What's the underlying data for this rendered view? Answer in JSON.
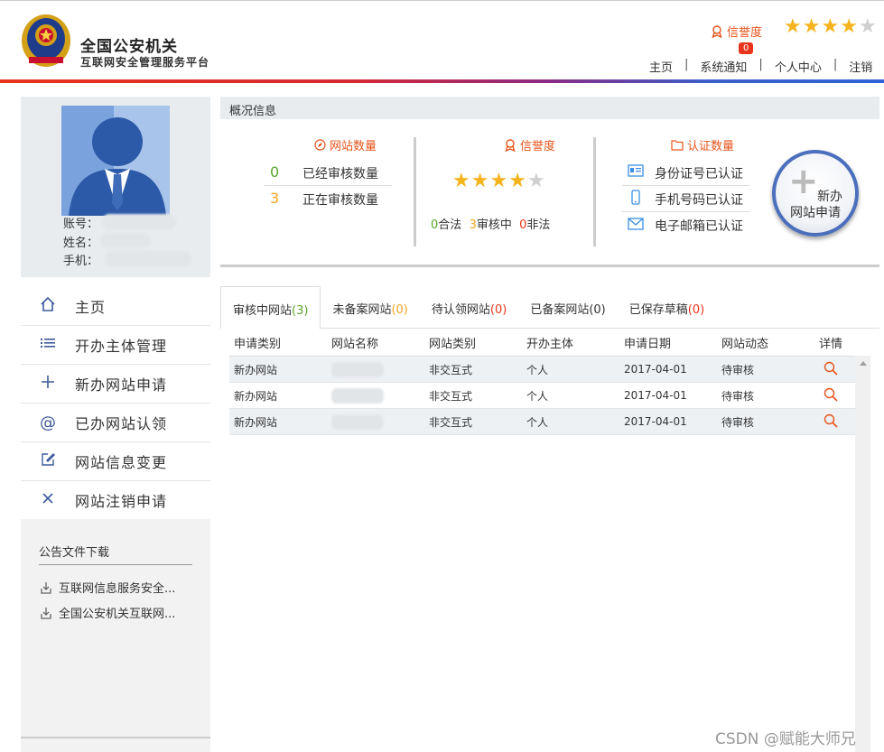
{
  "header": {
    "title": "全国公安机关",
    "subtitle": "互联网安全管理服务平台",
    "credit_label": "信誉度",
    "credit_stars": 4,
    "credit_stars_max": 5,
    "notice_count": "0",
    "nav": [
      "主页",
      "系统通知",
      "个人中心",
      "注销"
    ],
    "nav_sep": "|"
  },
  "profile": {
    "account_label": "账号：",
    "name_label": "姓名：",
    "phone_label": "手机："
  },
  "sidebar": {
    "items": [
      {
        "icon": "home-icon",
        "label": "主页"
      },
      {
        "icon": "list-icon",
        "label": "开办主体管理"
      },
      {
        "icon": "plus-icon",
        "label": "新办网站申请"
      },
      {
        "icon": "at-icon",
        "label": "已办网站认领"
      },
      {
        "icon": "edit-icon",
        "label": "网站信息变更"
      },
      {
        "icon": "close-icon",
        "label": "网站注销申请"
      }
    ],
    "downloads_title": "公告文件下载",
    "downloads": [
      "互联网信息服务安全...",
      "全国公安机关互联网..."
    ]
  },
  "overview": {
    "title": "概况信息",
    "site_count": {
      "title": "网站数量",
      "reviewed_value": "0",
      "reviewed_label": "已经审核数量",
      "reviewing_value": "3",
      "reviewing_label": "正在审核数量"
    },
    "credit": {
      "title": "信誉度",
      "stars": 4,
      "stars_max": 5,
      "legal_value": "0",
      "legal_label": "合法",
      "review_value": "3",
      "review_label": "审核中",
      "illegal_value": "0",
      "illegal_label": "非法"
    },
    "certification": {
      "title": "认证数量",
      "items": [
        "身份证号已认证",
        "手机号码已认证",
        "电子邮箱已认证"
      ]
    },
    "new_button": {
      "line1": "新办",
      "line2": "网站申请"
    }
  },
  "tabs": [
    {
      "label": "审核中网站",
      "count": "(3)",
      "count_color": "#5aa52c"
    },
    {
      "label": "未备案网站",
      "count": "(0)",
      "count_color": "#f5a623"
    },
    {
      "label": "待认领网站",
      "count": "(0)",
      "count_color": "#e8341c"
    },
    {
      "label": "已备案网站",
      "count": "(0)",
      "count_color": "#333333"
    },
    {
      "label": "已保存草稿",
      "count": "(0)",
      "count_color": "#e8341c"
    }
  ],
  "table": {
    "columns": [
      "申请类别",
      "网站名称",
      "网站类别",
      "开办主体",
      "申请日期",
      "网站动态",
      "详情"
    ],
    "rows": [
      {
        "category": "新办网站",
        "site_type": "非交互式",
        "entity": "个人",
        "date": "2017-04-01",
        "status": "待审核"
      },
      {
        "category": "新办网站",
        "site_type": "非交互式",
        "entity": "个人",
        "date": "2017-04-01",
        "status": "待审核"
      },
      {
        "category": "新办网站",
        "site_type": "非交互式",
        "entity": "个人",
        "date": "2017-04-01",
        "status": "待审核"
      }
    ]
  },
  "watermark": "CSDN @赋能大师兄",
  "colors": {
    "accent_orange": "#e8541c",
    "star_gold": "#f5b41e",
    "nav_blue": "#3d5a9c",
    "badge_red": "#e8341c"
  }
}
